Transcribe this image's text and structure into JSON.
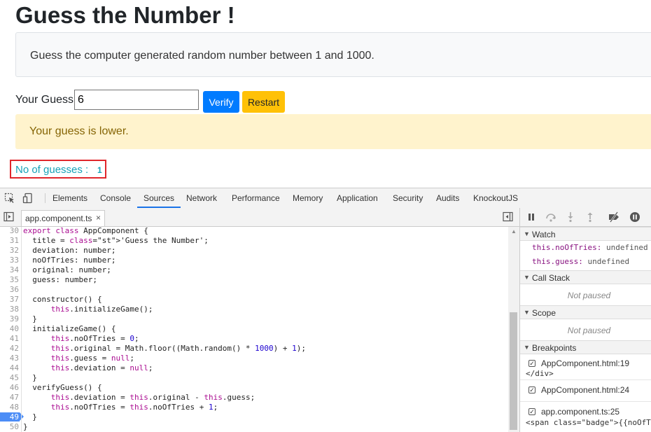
{
  "app": {
    "title": "Guess the Number !",
    "instructions": "Guess the computer generated random number between 1 and 1000.",
    "guess_label": "Your Guess:",
    "guess_value": "6",
    "verify_label": "Verify",
    "restart_label": "Restart",
    "alert_text": "Your guess is lower.",
    "guesses_label": "No of guesses :",
    "guesses_count": "1"
  },
  "devtools": {
    "tabs": [
      "Elements",
      "Console",
      "Sources",
      "Network",
      "Performance",
      "Memory",
      "Application",
      "Security",
      "Audits",
      "KnockoutJS"
    ],
    "active_tab": "Sources",
    "open_file": "app.component.ts",
    "close_glyph": "×",
    "code_lines": [
      {
        "n": "30",
        "t": "export class AppComponent {"
      },
      {
        "n": "31",
        "t": "  title = 'Guess the Number';"
      },
      {
        "n": "32",
        "t": "  deviation: number;"
      },
      {
        "n": "33",
        "t": "  noOfTries: number;"
      },
      {
        "n": "34",
        "t": "  original: number;"
      },
      {
        "n": "35",
        "t": "  guess: number;"
      },
      {
        "n": "36",
        "t": ""
      },
      {
        "n": "37",
        "t": "  constructor() {"
      },
      {
        "n": "38",
        "t": "      this.initializeGame();"
      },
      {
        "n": "39",
        "t": "  }"
      },
      {
        "n": "40",
        "t": "  initializeGame() {"
      },
      {
        "n": "41",
        "t": "      this.noOfTries = 0;"
      },
      {
        "n": "42",
        "t": "      this.original = Math.floor((Math.random() * 1000) + 1);"
      },
      {
        "n": "43",
        "t": "      this.guess = null;"
      },
      {
        "n": "44",
        "t": "      this.deviation = null;"
      },
      {
        "n": "45",
        "t": "  }"
      },
      {
        "n": "46",
        "t": "  verifyGuess() {"
      },
      {
        "n": "47",
        "t": "      this.deviation = this.original - this.guess;"
      },
      {
        "n": "48",
        "t": "      this.noOfTries = this.noOfTries + 1;"
      },
      {
        "n": "49",
        "t": "  }"
      },
      {
        "n": "50",
        "t": "}"
      }
    ],
    "breakpoint_line": "49",
    "sidebar": {
      "watch_label": "Watch",
      "watch_items": [
        {
          "key": "this.noOfTries:",
          "value": "undefined"
        },
        {
          "key": "this.guess:",
          "value": "undefined"
        }
      ],
      "call_stack_label": "Call Stack",
      "call_stack_status": "Not paused",
      "scope_label": "Scope",
      "scope_status": "Not paused",
      "breakpoints_label": "Breakpoints",
      "breakpoints": [
        {
          "name": "AppComponent.html:19",
          "code": "</div>"
        },
        {
          "name": "AppComponent.html:24",
          "code": ""
        },
        {
          "name": "app.component.ts:25",
          "code": "<span class=\"badge\">{{noOfT"
        }
      ]
    }
  },
  "colors": {
    "primary": "#007bff",
    "warning": "#ffc107",
    "alert_bg": "#fff3cd",
    "alert_text": "#856404",
    "info": "#17a2b8",
    "highlight_box": "#e0262b",
    "breakpoint": "#4c8df6"
  }
}
